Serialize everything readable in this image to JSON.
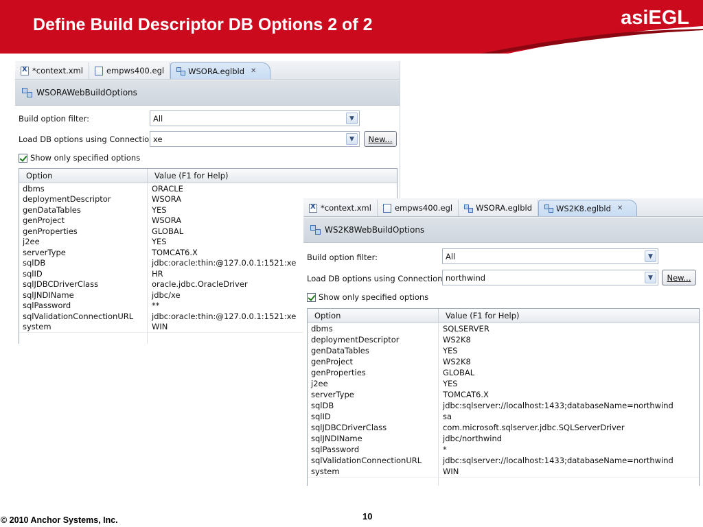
{
  "slide": {
    "title": "Define Build Descriptor DB Options 2 of 2",
    "brand": "asiEGL",
    "copyright": "© 2010 Anchor Systems, Inc.",
    "page_number": "10",
    "banner_color": "#cc0a1e"
  },
  "panels": [
    {
      "tabs": [
        {
          "label": "*context.xml",
          "icon": "xml-file-icon",
          "active": false
        },
        {
          "label": "empws400.egl",
          "icon": "egl-file-icon",
          "active": false
        },
        {
          "label": "WSORA.eglbld",
          "icon": "build-descriptor-icon",
          "active": true
        }
      ],
      "form_title": "WSORAWebBuildOptions",
      "filter_label": "Build option filter:",
      "filter_value": "All",
      "connection_label": "Load DB options using Connection:",
      "connection_value": "xe",
      "new_button": "New...",
      "checkbox_label": "Show only specified options",
      "checkbox_checked": true,
      "columns": [
        "Option",
        "Value (F1 for Help)"
      ],
      "rows": [
        [
          "dbms",
          "ORACLE"
        ],
        [
          "deploymentDescriptor",
          "WSORA"
        ],
        [
          "genDataTables",
          "YES"
        ],
        [
          "genProject",
          "WSORA"
        ],
        [
          "genProperties",
          "GLOBAL"
        ],
        [
          "j2ee",
          "YES"
        ],
        [
          "serverType",
          "TOMCAT6.X"
        ],
        [
          "sqlDB",
          "jdbc:oracle:thin:@127.0.0.1:1521:xe"
        ],
        [
          "sqlID",
          "HR"
        ],
        [
          "sqlJDBCDriverClass",
          "oracle.jdbc.OracleDriver"
        ],
        [
          "sqlJNDIName",
          "jdbc/xe"
        ],
        [
          "sqlPassword",
          "**"
        ],
        [
          "sqlValidationConnectionURL",
          "jdbc:oracle:thin:@127.0.0.1:1521:xe"
        ],
        [
          "system",
          "WIN"
        ]
      ]
    },
    {
      "tabs": [
        {
          "label": "*context.xml",
          "icon": "xml-file-icon",
          "active": false
        },
        {
          "label": "empws400.egl",
          "icon": "egl-file-icon",
          "active": false
        },
        {
          "label": "WSORA.eglbld",
          "icon": "build-descriptor-icon",
          "active": false
        },
        {
          "label": "WS2K8.eglbld",
          "icon": "build-descriptor-icon",
          "active": true
        }
      ],
      "form_title": "WS2K8WebBuildOptions",
      "filter_label": "Build option filter:",
      "filter_value": "All",
      "connection_label": "Load DB options using Connection:",
      "connection_value": "northwind",
      "new_button": "New...",
      "checkbox_label": "Show only specified options",
      "checkbox_checked": true,
      "columns": [
        "Option",
        "Value (F1 for Help)"
      ],
      "rows": [
        [
          "dbms",
          "SQLSERVER"
        ],
        [
          "deploymentDescriptor",
          "WS2K8"
        ],
        [
          "genDataTables",
          "YES"
        ],
        [
          "genProject",
          "WS2K8"
        ],
        [
          "genProperties",
          "GLOBAL"
        ],
        [
          "j2ee",
          "YES"
        ],
        [
          "serverType",
          "TOMCAT6.X"
        ],
        [
          "sqlDB",
          "jdbc:sqlserver://localhost:1433;databaseName=northwind"
        ],
        [
          "sqlID",
          "sa"
        ],
        [
          "sqlJDBCDriverClass",
          "com.microsoft.sqlserver.jdbc.SQLServerDriver"
        ],
        [
          "sqlJNDIName",
          "jdbc/northwind"
        ],
        [
          "sqlPassword",
          "*"
        ],
        [
          "sqlValidationConnectionURL",
          "jdbc:sqlserver://localhost:1433;databaseName=northwind"
        ],
        [
          "system",
          "WIN"
        ]
      ]
    }
  ]
}
